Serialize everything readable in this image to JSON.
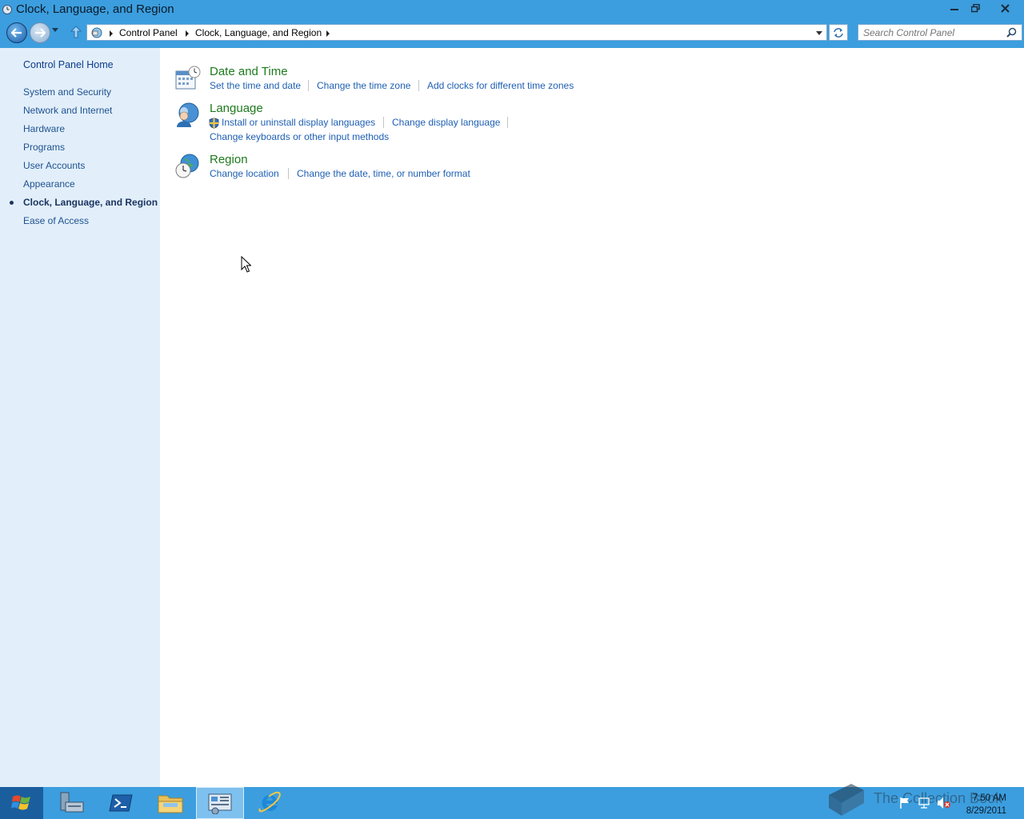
{
  "window": {
    "title": "Clock, Language, and Region"
  },
  "address": {
    "crumbs": [
      "Control Panel",
      "Clock, Language, and Region"
    ],
    "search_placeholder": "Search Control Panel"
  },
  "sidebar": {
    "home": "Control Panel Home",
    "items": [
      {
        "label": "System and Security"
      },
      {
        "label": "Network and Internet"
      },
      {
        "label": "Hardware"
      },
      {
        "label": "Programs"
      },
      {
        "label": "User Accounts"
      },
      {
        "label": "Appearance"
      },
      {
        "label": "Clock, Language, and Region",
        "active": true
      },
      {
        "label": "Ease of Access"
      }
    ]
  },
  "categories": {
    "datetime": {
      "title": "Date and Time",
      "links": [
        "Set the time and date",
        "Change the time zone",
        "Add clocks for different time zones"
      ]
    },
    "language": {
      "title": "Language",
      "links": [
        "Install or uninstall display languages",
        "Change display language",
        "Change keyboards or other input methods"
      ]
    },
    "region": {
      "title": "Region",
      "links": [
        "Change location",
        "Change the date, time, or number format"
      ]
    }
  },
  "taskbar": {
    "apps": [
      "server-manager-icon",
      "powershell-icon",
      "file-explorer-icon",
      "control-panel-icon",
      "internet-explorer-icon"
    ],
    "active_app": "control-panel-icon",
    "clock_time": "7:50 AM",
    "clock_date": "8/29/2011",
    "watermark": "The Collection Book"
  },
  "colors": {
    "chrome": "#3c9ede",
    "sidebar": "#e2effa",
    "link": "#1e5fb3",
    "category_title": "#1e7a1e"
  }
}
